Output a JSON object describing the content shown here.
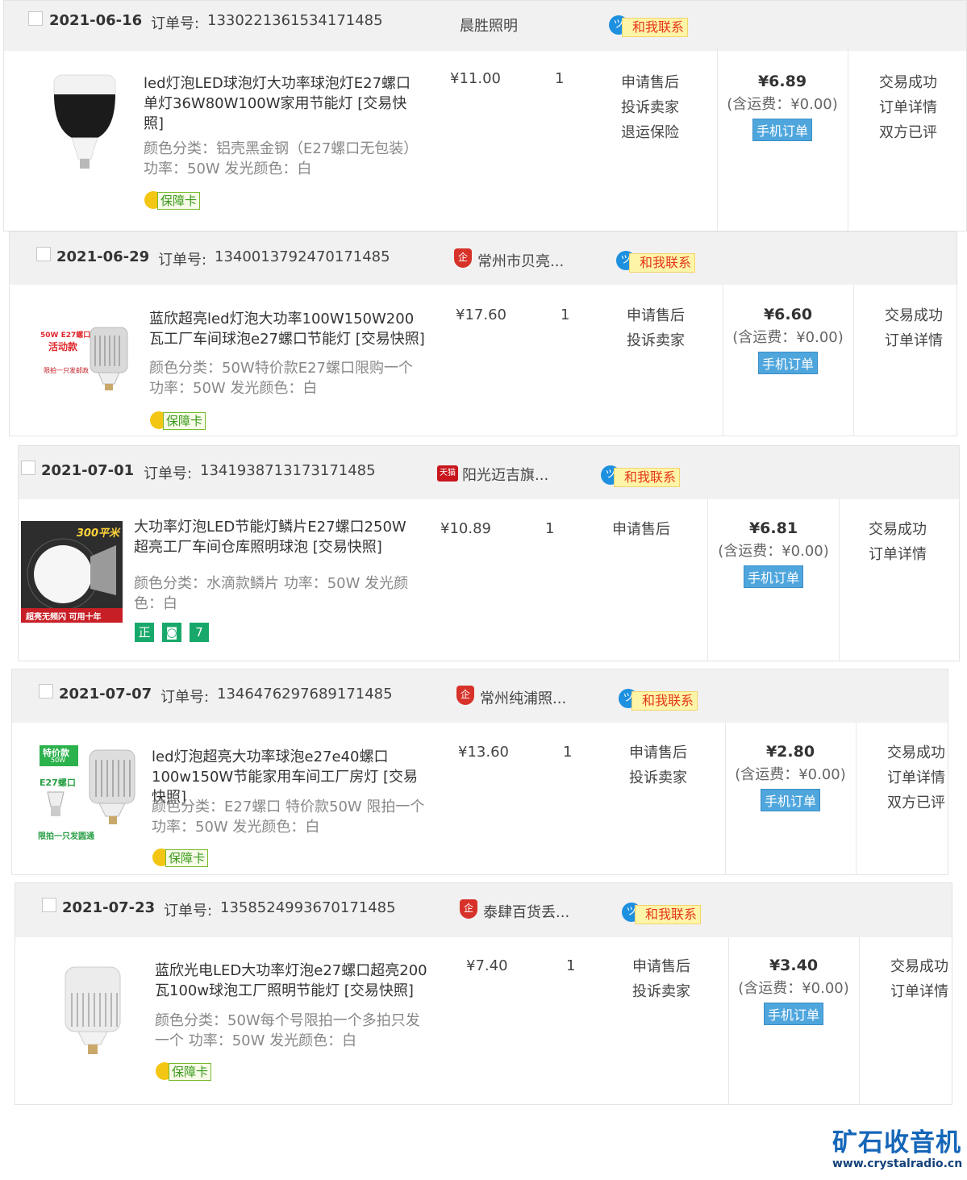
{
  "orders": [
    {
      "date": "2021-06-16",
      "order_no_label": "订单号:",
      "order_no": "1330221361534171485",
      "shop": "晨胜照明",
      "shop_icon": "none",
      "contact": "和我联系",
      "title": "led灯泡LED球泡灯大功率球泡灯E27螺口单灯36W80W100W家用节能灯 [交易快照]",
      "attrs": "颜色分类：铝壳黑金钢（E27螺口无包装） 功率：50W  发光颜色：白",
      "badge": "保障卡",
      "price": "¥11.00",
      "qty": "1",
      "services": [
        "申请售后",
        "投诉卖家",
        "退运保险"
      ],
      "total": "¥6.89",
      "shipping": "(含运费：¥0.00)",
      "mobile": "手机订单",
      "status": [
        "交易成功",
        "订单详情",
        "双方已评"
      ]
    },
    {
      "date": "2021-06-29",
      "order_no_label": "订单号:",
      "order_no": "1340013792470171485",
      "shop": "常州市贝亮...",
      "shop_icon": "企",
      "contact": "和我联系",
      "title": "蓝欣超亮led灯泡大功率100W150W200瓦工厂车间球泡e27螺口节能灯 [交易快照]",
      "attrs": "颜色分类：50W特价款E27螺口限购一个 功率：50W  发光颜色：白",
      "badge": "保障卡",
      "thumb_text": [
        "50W E27螺口",
        "活动款",
        "限拍一只发邮政"
      ],
      "price": "¥17.60",
      "qty": "1",
      "services": [
        "申请售后",
        "投诉卖家"
      ],
      "total": "¥6.60",
      "shipping": "(含运费：¥0.00)",
      "mobile": "手机订单",
      "status": [
        "交易成功",
        "订单详情"
      ]
    },
    {
      "date": "2021-07-01",
      "order_no_label": "订单号:",
      "order_no": "1341938713173171485",
      "shop": "阳光迈吉旗...",
      "shop_icon": "天猫",
      "contact": "和我联系",
      "title": "大功率灯泡LED节能灯鳞片E27螺口250W超亮工厂车间仓库照明球泡 [交易快照]",
      "attrs": "颜色分类：水滴款鳞片  功率：50W  发光颜色：白",
      "badges": [
        "正",
        "◙",
        "7"
      ],
      "thumb_text": [
        "300平米",
        "超亮无频闪 可用十年"
      ],
      "price": "¥10.89",
      "qty": "1",
      "services": [
        "申请售后"
      ],
      "total": "¥6.81",
      "shipping": "(含运费：¥0.00)",
      "mobile": "手机订单",
      "status": [
        "交易成功",
        "订单详情"
      ]
    },
    {
      "date": "2021-07-07",
      "order_no_label": "订单号:",
      "order_no": "1346476297689171485",
      "shop": "常州纯浦照...",
      "shop_icon": "企",
      "contact": "和我联系",
      "title": "led灯泡超亮大功率球泡e27e40螺口100w150W节能家用车间工厂房灯 [交易快照]",
      "attrs": "颜色分类：E27螺口 特价款50W 限拍一个  功率：50W  发光颜色：白",
      "badge": "保障卡",
      "thumb_text": [
        "特价款",
        "50W",
        "E27螺口",
        "限拍一只发圆通"
      ],
      "price": "¥13.60",
      "qty": "1",
      "services": [
        "申请售后",
        "投诉卖家"
      ],
      "total": "¥2.80",
      "shipping": "(含运费：¥0.00)",
      "mobile": "手机订单",
      "status": [
        "交易成功",
        "订单详情",
        "双方已评"
      ]
    },
    {
      "date": "2021-07-23",
      "order_no_label": "订单号:",
      "order_no": "1358524993670171485",
      "shop": "泰肆百货丢...",
      "shop_icon": "企",
      "contact": "和我联系",
      "title": "蓝欣光电LED大功率灯泡e27螺口超亮200瓦100w球泡工厂照明节能灯 [交易快照]",
      "attrs": "颜色分类：50W每个号限拍一个多拍只发一个  功率：50W  发光颜色：白",
      "badge": "保障卡",
      "price": "¥7.40",
      "qty": "1",
      "services": [
        "申请售后",
        "投诉卖家"
      ],
      "total": "¥3.40",
      "shipping": "(含运费：¥0.00)",
      "mobile": "手机订单",
      "status": [
        "交易成功",
        "订单详情"
      ]
    }
  ],
  "watermark": {
    "title": "矿石收音机",
    "url": "www.crystalradio.cn"
  },
  "colors": {
    "header_bg": "#f1f1f1",
    "contact_text": "#e3361a",
    "mobile_btn": "#4fa6dd",
    "guarantee_green": "#3a9a1c",
    "logo_blue": "#1566b8"
  }
}
